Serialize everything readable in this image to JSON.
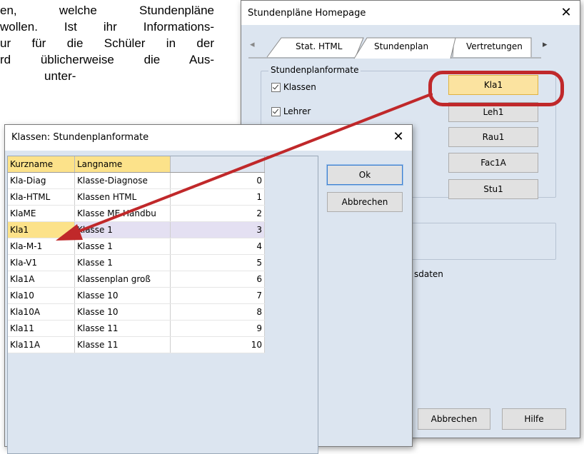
{
  "doc": {
    "lines": [
      "en, welche Stundenpläne",
      "wollen. Ist ihr Informations-",
      "ur für die Schüler in der",
      "rd üblicherweise die Aus-",
      "unter-"
    ]
  },
  "homepage_dialog": {
    "title": "Stundenpläne Homepage",
    "close_glyph": "✕",
    "tab_scroll_left": "◂",
    "tab_scroll_right": "▸",
    "tabs": [
      "Stat. HTML",
      "Stundenplan",
      "Vertretungen"
    ],
    "group_label": "Stundenplanformate",
    "checkboxes": [
      {
        "label": "Klassen",
        "checked": true
      },
      {
        "label": "Lehrer",
        "checked": true
      }
    ],
    "format_buttons": [
      "Kla1",
      "Leh1",
      "Rau1",
      "Fac1A",
      "Stu1"
    ],
    "partial_text": "sdaten",
    "footer_buttons": {
      "cancel": "Abbrechen",
      "help": "Hilfe"
    }
  },
  "format_dialog": {
    "title": "Klassen: Stundenplanformate",
    "close_glyph": "✕",
    "columns": [
      "Kurzname",
      "Langname",
      ""
    ],
    "rows": [
      {
        "short": "Kla-Diag",
        "long": "Klasse-Diagnose",
        "num": "0"
      },
      {
        "short": "Kla-HTML",
        "long": "Klassen HTML",
        "num": "1"
      },
      {
        "short": "KlaME",
        "long": "Klasse ME Handbu",
        "num": "2"
      },
      {
        "short": "Kla1",
        "long": "Klasse 1",
        "num": "3"
      },
      {
        "short": "Kla-M-1",
        "long": "Klasse 1",
        "num": "4"
      },
      {
        "short": "Kla-V1",
        "long": "Klasse 1",
        "num": "5"
      },
      {
        "short": "Kla1A",
        "long": "Klassenplan groß",
        "num": "6"
      },
      {
        "short": "Kla10",
        "long": "Klasse 10",
        "num": "7"
      },
      {
        "short": "Kla10A",
        "long": "Klasse 10",
        "num": "8"
      },
      {
        "short": "Kla11",
        "long": "Klasse 11",
        "num": "9"
      },
      {
        "short": "Kla11A",
        "long": "Klasse 11",
        "num": "10"
      }
    ],
    "selected_row": 3,
    "ok_label": "Ok",
    "cancel_label": "Abbrechen"
  },
  "colors": {
    "highlight_ring": "#c0282a",
    "arrow": "#c0282a",
    "selected_cell": "#fce28a",
    "selected_row": "#e4e0f2",
    "header_bg": "#dfe6f0",
    "dialog_body": "#dce5f0"
  }
}
